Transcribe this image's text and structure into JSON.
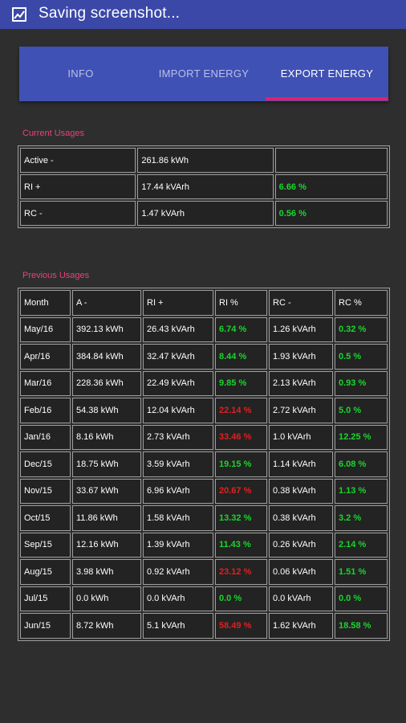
{
  "status_bar": {
    "text": "Saving screenshot..."
  },
  "tabs": [
    {
      "label": "INFO",
      "active": false
    },
    {
      "label": "IMPORT ENERGY",
      "active": false
    },
    {
      "label": "EXPORT ENERGY",
      "active": true
    }
  ],
  "colors": {
    "accent": "#e91e63",
    "tab_bar": "#3f51b5",
    "status_bar": "#3b48a8",
    "positive": "#19d62c",
    "negative": "#e02020",
    "section_title": "#ec407a"
  },
  "current": {
    "title": "Current Usages",
    "rows": [
      {
        "label": "Active -",
        "value": "261.86 kWh",
        "pct": "",
        "pct_color": ""
      },
      {
        "label": "RI +",
        "value": "17.44 kVArh",
        "pct": "6.66 %",
        "pct_color": "green"
      },
      {
        "label": "RC -",
        "value": "1.47 kVArh",
        "pct": "0.56 %",
        "pct_color": "green"
      }
    ]
  },
  "previous": {
    "title": "Previous Usages",
    "headers": [
      "Month",
      "A -",
      "RI +",
      "RI %",
      "RC -",
      "RC %"
    ],
    "rows": [
      {
        "month": "May/16",
        "a": "392.13 kWh",
        "ri": "26.43 kVArh",
        "ri_pct": "6.74 %",
        "ri_color": "green",
        "rc": "1.26 kVArh",
        "rc_pct": "0.32 %",
        "rc_color": "green"
      },
      {
        "month": "Apr/16",
        "a": "384.84 kWh",
        "ri": "32.47 kVArh",
        "ri_pct": "8.44 %",
        "ri_color": "green",
        "rc": "1.93 kVArh",
        "rc_pct": "0.5 %",
        "rc_color": "green"
      },
      {
        "month": "Mar/16",
        "a": "228.36 kWh",
        "ri": "22.49 kVArh",
        "ri_pct": "9.85 %",
        "ri_color": "green",
        "rc": "2.13 kVArh",
        "rc_pct": "0.93 %",
        "rc_color": "green"
      },
      {
        "month": "Feb/16",
        "a": "54.38 kWh",
        "ri": "12.04 kVArh",
        "ri_pct": "22.14 %",
        "ri_color": "red",
        "rc": "2.72 kVArh",
        "rc_pct": "5.0 %",
        "rc_color": "green"
      },
      {
        "month": "Jan/16",
        "a": "8.16 kWh",
        "ri": "2.73 kVArh",
        "ri_pct": "33.46 %",
        "ri_color": "red",
        "rc": "1.0 kVArh",
        "rc_pct": "12.25 %",
        "rc_color": "green"
      },
      {
        "month": "Dec/15",
        "a": "18.75 kWh",
        "ri": "3.59 kVArh",
        "ri_pct": "19.15 %",
        "ri_color": "green",
        "rc": "1.14 kVArh",
        "rc_pct": "6.08 %",
        "rc_color": "green"
      },
      {
        "month": "Nov/15",
        "a": "33.67 kWh",
        "ri": "6.96 kVArh",
        "ri_pct": "20.67 %",
        "ri_color": "red",
        "rc": "0.38 kVArh",
        "rc_pct": "1.13 %",
        "rc_color": "green"
      },
      {
        "month": "Oct/15",
        "a": "11.86 kWh",
        "ri": "1.58 kVArh",
        "ri_pct": "13.32 %",
        "ri_color": "green",
        "rc": "0.38 kVArh",
        "rc_pct": "3.2 %",
        "rc_color": "green"
      },
      {
        "month": "Sep/15",
        "a": "12.16 kWh",
        "ri": "1.39 kVArh",
        "ri_pct": "11.43 %",
        "ri_color": "green",
        "rc": "0.26 kVArh",
        "rc_pct": "2.14 %",
        "rc_color": "green"
      },
      {
        "month": "Aug/15",
        "a": "3.98 kWh",
        "ri": "0.92 kVArh",
        "ri_pct": "23.12 %",
        "ri_color": "red",
        "rc": "0.06 kVArh",
        "rc_pct": "1.51 %",
        "rc_color": "green"
      },
      {
        "month": "Jul/15",
        "a": "0.0 kWh",
        "ri": "0.0 kVArh",
        "ri_pct": "0.0 %",
        "ri_color": "green",
        "rc": "0.0 kVArh",
        "rc_pct": "0.0 %",
        "rc_color": "green"
      },
      {
        "month": "Jun/15",
        "a": "8.72 kWh",
        "ri": "5.1 kVArh",
        "ri_pct": "58.49 %",
        "ri_color": "red",
        "rc": "1.62 kVArh",
        "rc_pct": "18.58 %",
        "rc_color": "green"
      }
    ]
  }
}
